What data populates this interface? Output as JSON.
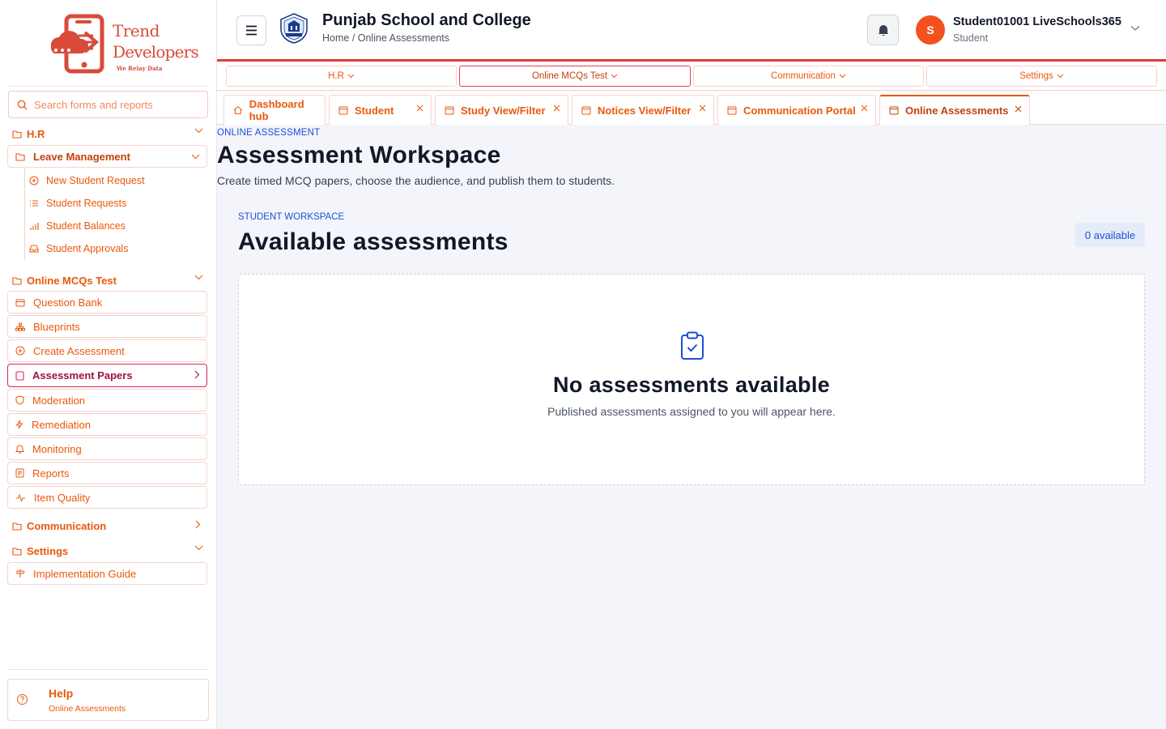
{
  "brand": {
    "line1": "Trend",
    "line2": "Developers",
    "tagline": "We Relay Data"
  },
  "sidebar": {
    "search_placeholder": "Search forms and reports",
    "hr_label": "H.R",
    "leave_management": "Leave Management",
    "leave_items": [
      "New Student Request",
      "Student Requests",
      "Student Balances",
      "Student Approvals"
    ],
    "mcq_label": "Online MCQs Test",
    "mcq_items": [
      "Question Bank",
      "Blueprints",
      "Create Assessment",
      "Assessment Papers",
      "Moderation",
      "Remediation",
      "Monitoring",
      "Reports",
      "Item Quality"
    ],
    "communication_label": "Communication",
    "settings_label": "Settings",
    "impl_guide": "Implementation Guide",
    "help_title": "Help",
    "help_sub": "Online Assessments"
  },
  "header": {
    "school": "Punjab School and College",
    "breadcrumb": "Home / Online Assessments",
    "avatar_initial": "S",
    "user_name": "Student01001 LiveSchools365",
    "user_role": "Student"
  },
  "top_menu": [
    "H.R",
    "Online MCQs Test",
    "Communication",
    "Settings"
  ],
  "tabs": [
    "Dashboard hub",
    "Student",
    "Study View/Filter",
    "Notices View/Filter",
    "Communication Portal",
    "Online Assessments"
  ],
  "main": {
    "kicker": "ONLINE ASSESSMENT",
    "title": "Assessment Workspace",
    "description": "Create timed MCQ papers, choose the audience, and publish them to students.",
    "section_kicker": "STUDENT WORKSPACE",
    "section_title": "Available assessments",
    "badge": "0 available",
    "empty_title": "No assessments available",
    "empty_desc": "Published assessments assigned to you will appear here."
  },
  "colors": {
    "accent": "#ea580c",
    "header_border": "#e53935",
    "link_blue": "#1d4ed8",
    "avatar": "#f4511e"
  }
}
